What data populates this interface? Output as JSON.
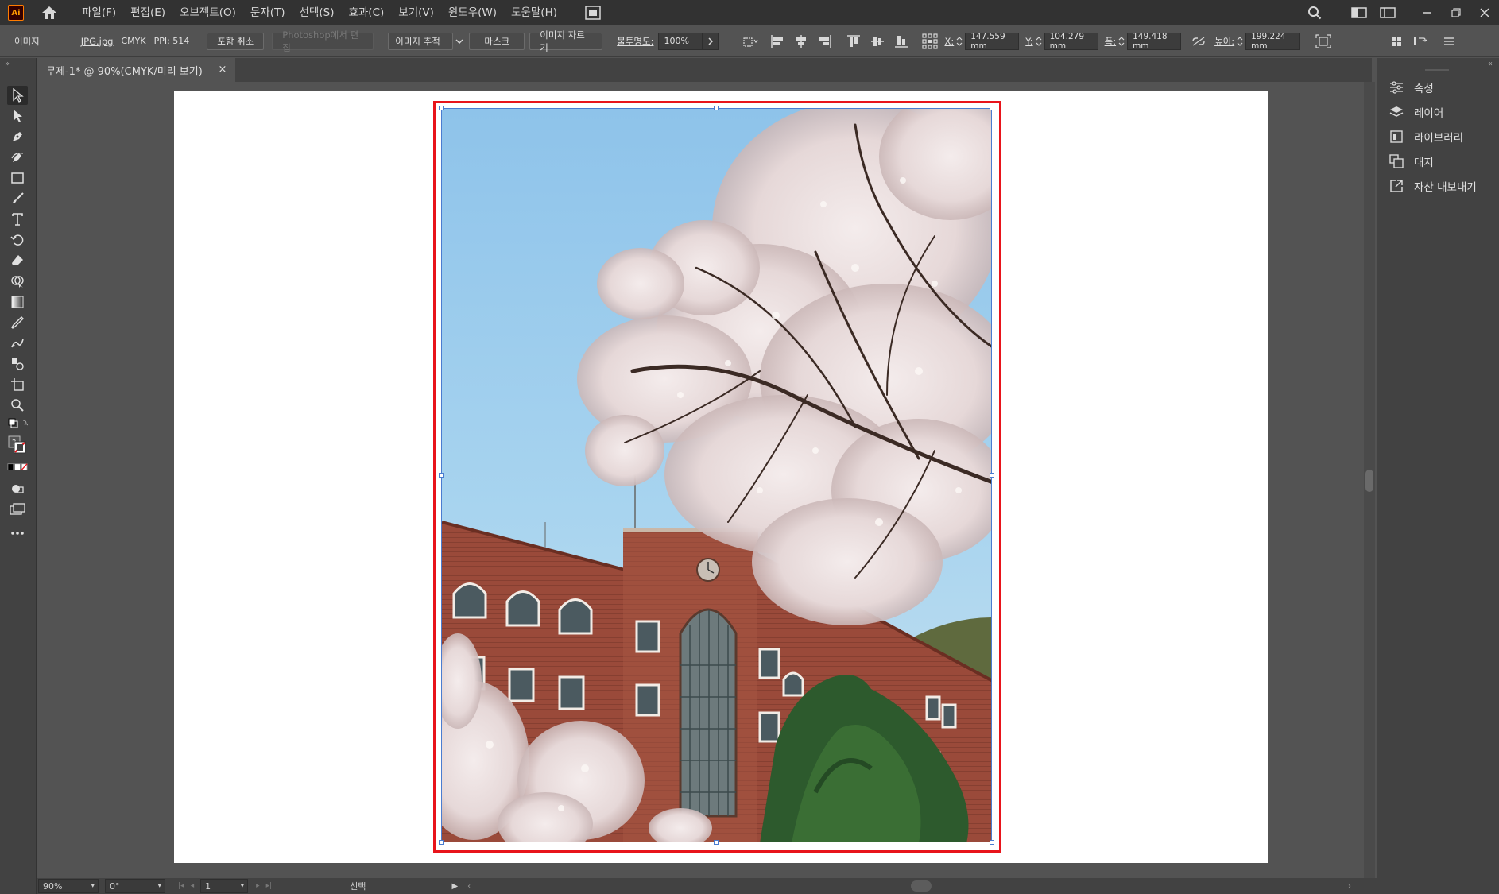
{
  "app": {
    "logo_text": "Ai",
    "menu": [
      "파일(F)",
      "편집(E)",
      "오브젝트(O)",
      "문자(T)",
      "선택(S)",
      "효과(C)",
      "보기(V)",
      "윈도우(W)",
      "도움말(H)"
    ]
  },
  "control_bar": {
    "selection_type": "이미지",
    "file_name": "JPG.jpg",
    "color_mode": "CMYK",
    "ppi": "PPI: 514",
    "embed_cancel": "포함 취소",
    "photoshop_edit": "Photoshop에서 편집",
    "image_trace": "이미지 추적",
    "mask": "마스크",
    "crop_image": "이미지 자르기",
    "opacity_label": "불투명도:",
    "opacity_value": "100%",
    "x_label": "X:",
    "x_value": "147.559 mm",
    "y_label": "Y:",
    "y_value": "104.279 mm",
    "w_label": "폭:",
    "w_value": "149.418 mm",
    "h_label": "높이:",
    "h_value": "199.224 mm"
  },
  "document_tab": {
    "title": "무제-1* @ 90%(CMYK/미리 보기)",
    "close": "×"
  },
  "right_panel": {
    "items": [
      {
        "label": "속성",
        "icon": "properties-icon"
      },
      {
        "label": "레이어",
        "icon": "layers-icon"
      },
      {
        "label": "라이브러리",
        "icon": "libraries-icon"
      },
      {
        "label": "대지",
        "icon": "artboards-icon"
      },
      {
        "label": "자산 내보내기",
        "icon": "export-icon"
      }
    ]
  },
  "status_bar": {
    "zoom": "90%",
    "rotation": "0°",
    "artboard_number": "1",
    "tool_status": "선택"
  },
  "colors": {
    "selection_highlight": "#e8141b",
    "bounding_box": "#4a7cd0",
    "ui_dark": "#323232",
    "ui_mid": "#535353"
  }
}
